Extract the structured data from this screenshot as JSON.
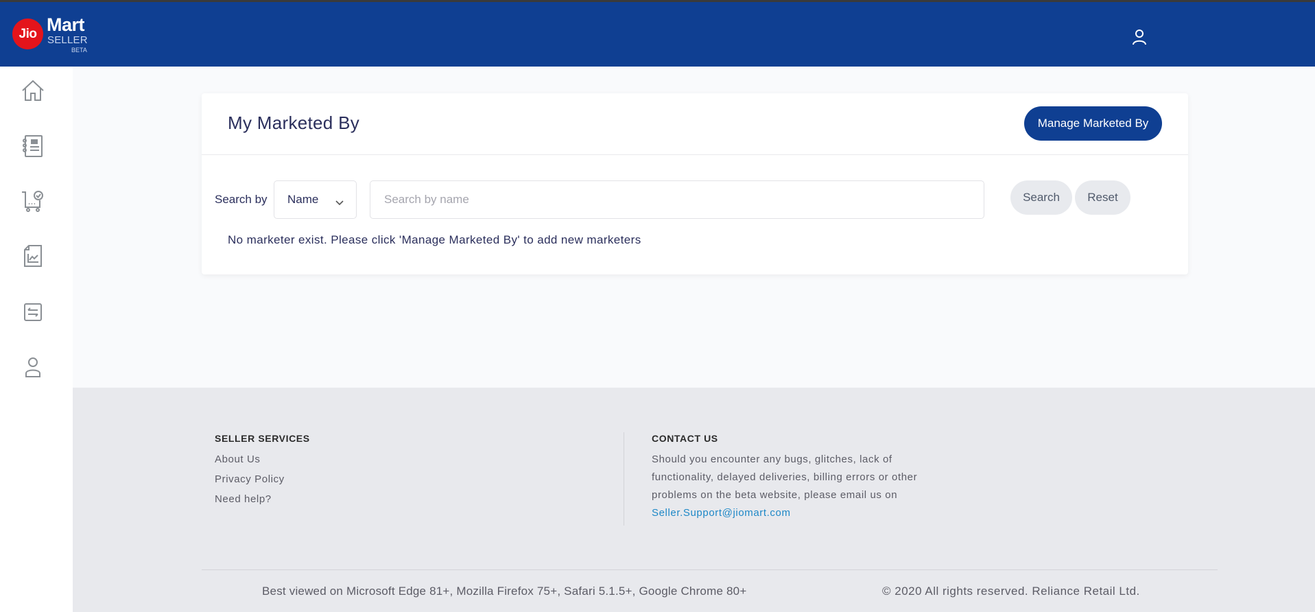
{
  "header": {
    "logo": {
      "brand": "Jio",
      "name": "Mart",
      "sub": "SELLER",
      "tag": "BETA"
    },
    "user_icon": "user-icon"
  },
  "sidebar": {
    "items": [
      {
        "icon": "home-icon",
        "label": "Home"
      },
      {
        "icon": "catalog-icon",
        "label": "Catalog"
      },
      {
        "icon": "orders-cart-icon",
        "label": "Orders"
      },
      {
        "icon": "reports-icon",
        "label": "Reports"
      },
      {
        "icon": "transactions-icon",
        "label": "Transactions"
      },
      {
        "icon": "profile-icon",
        "label": "Profile"
      }
    ]
  },
  "card": {
    "title": "My Marketed By",
    "manage_button": "Manage Marketed By",
    "search_label": "Search by",
    "search_by_selected": "Name",
    "search_placeholder": "Search by name",
    "search_value": "",
    "search_button": "Search",
    "reset_button": "Reset",
    "empty_message": "No marketer exist. Please click 'Manage Marketed By' to add new marketers"
  },
  "footer": {
    "services_heading": "SELLER SERVICES",
    "services_links": [
      "About Us",
      "Privacy Policy",
      "Need help?"
    ],
    "contact_heading": "CONTACT US",
    "contact_text": "Should you encounter any bugs, glitches, lack of functionality, delayed deliveries, billing errors or other problems on the beta website, please email us on ",
    "contact_email": "Seller.Support@jiomart.com",
    "best_viewed": "Best viewed on Microsoft Edge 81+, Mozilla Firefox 75+, Safari 5.1.5+, Google Chrome 80+",
    "copyright": "© 2020 All rights reserved. Reliance Retail Ltd."
  },
  "colors": {
    "brand_blue": "#0f3f92",
    "jio_red": "#e4141b",
    "link_blue": "#1e88c7"
  }
}
